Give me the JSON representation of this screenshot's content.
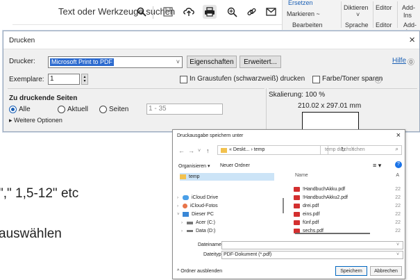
{
  "slide": {
    "line1": "\",\" 1,5-12\" etc",
    "line2": "auswählen"
  },
  "toolbar": {
    "search_text": "Text oder Werkzeuge suchen",
    "icons": [
      "search-icon",
      "save-icon",
      "upload-icon",
      "print-icon",
      "zoom-icon",
      "link-icon",
      "mail-icon"
    ]
  },
  "ribbon": {
    "replace": "Ersetzen",
    "mark": "Markieren ~",
    "edit_group": "Bearbeiten",
    "dictate": "Diktieren",
    "dictate_arrow": "˅",
    "speech_group": "Sprache",
    "editor": "Editor",
    "editor_group": "Editor",
    "addins": "Add-",
    "addins2": "Ins",
    "addins_group": "Add-Ins"
  },
  "print_dialog": {
    "title": "Drucken",
    "printer_label": "Drucker:",
    "printer_value": "Microsoft Print to PDF",
    "properties_button": "Eigenschaften",
    "advanced_button": "Erweitert...",
    "help_link": "Hilfe",
    "copies_label": "Exemplare:",
    "copies_value": "1",
    "grayscale_label": "In Graustufen (schwarzweiß) drucken",
    "save_ink_label": "Farbe/Toner sparen",
    "pages_heading": "Zu druckende Seiten",
    "radio_all": "Alle",
    "radio_current": "Aktuell",
    "radio_pages": "Seiten",
    "pages_range": "1 - 35",
    "more_options": "Weitere Optionen",
    "scale_label": "Skalierung: 100 %",
    "paper_size": "210.02 x 297.01 mm"
  },
  "save_dialog": {
    "title": "Druckausgabe speichern unter",
    "address": "« Deskt... › temp",
    "search_placeholder": "temp durchsuchen",
    "organize": "Organisieren ▾",
    "new_folder": "Neuer Ordner",
    "col_name": "Name",
    "col_date": "Ä",
    "nav_items": [
      {
        "label": "temp",
        "icon": "folder-icon"
      },
      {
        "label": "iCloud Drive",
        "icon": "cloud-icon"
      },
      {
        "label": "iCloud-Fotos",
        "icon": "photos-icon"
      },
      {
        "label": "Dieser PC",
        "icon": "pc-icon"
      },
      {
        "label": "Acer (C:)",
        "icon": "drive-icon"
      },
      {
        "label": "Data (D:)",
        "icon": "drive-icon"
      }
    ],
    "files": [
      {
        "name": "!HandbuchAkku.pdf",
        "date": "22"
      },
      {
        "name": "!HandbuchAkku2.pdf",
        "date": "22"
      },
      {
        "name": "drei.pdf",
        "date": "22"
      },
      {
        "name": "eins.pdf",
        "date": "22"
      },
      {
        "name": "fünf.pdf",
        "date": "22"
      },
      {
        "name": "sechs.pdf",
        "date": "22"
      }
    ],
    "filename_label": "Dateiname:",
    "filename_value": "",
    "filetype_label": "Dateityp:",
    "filetype_value": "PDF-Dokument (*.pdf)",
    "hide_folders": "Ordner ausblenden",
    "save_button": "Speichern",
    "cancel_button": "Abbrechen"
  },
  "colors": {
    "selection": "#2d6bcf",
    "link": "#1a5fb4",
    "pdf_red": "#d32f2f",
    "folder_yellow": "#f2c14e"
  }
}
